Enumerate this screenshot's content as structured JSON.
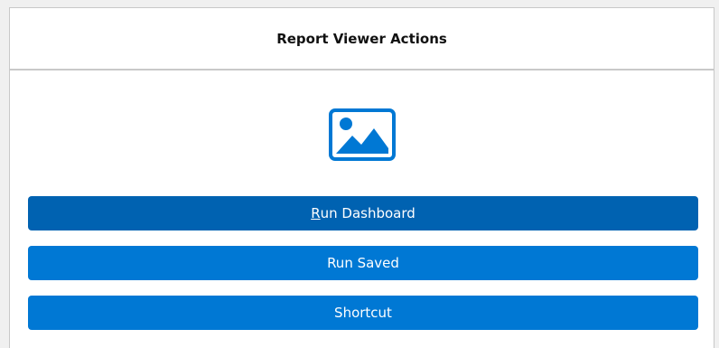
{
  "panel": {
    "title": "Report Viewer Actions",
    "icon": "image-icon"
  },
  "buttons": {
    "run_dashboard": {
      "mnemonic": "R",
      "rest": "un Dashboard"
    },
    "run_saved": {
      "label": "Run Saved"
    },
    "shortcut": {
      "label": "Shortcut"
    }
  },
  "colors": {
    "accent": "#0078d4",
    "accent_focused": "#0062b1",
    "header_text": "#111111",
    "border": "#c9c9c9"
  }
}
